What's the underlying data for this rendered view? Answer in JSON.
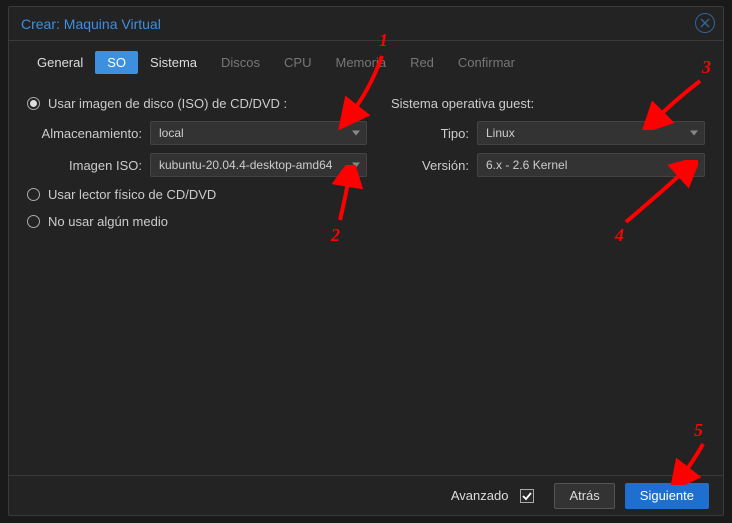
{
  "dialog": {
    "title": "Crear: Maquina Virtual"
  },
  "tabs": {
    "general": "General",
    "so": "SO",
    "sistema": "Sistema",
    "discos": "Discos",
    "cpu": "CPU",
    "memoria": "Memoria",
    "red": "Red",
    "confirmar": "Confirmar"
  },
  "left": {
    "radio_iso": "Usar imagen de disco (ISO) de CD/DVD :",
    "storage_label": "Almacenamiento:",
    "storage_value": "local",
    "iso_label": "Imagen ISO:",
    "iso_value": "kubuntu-20.04.4-desktop-amd64",
    "radio_physical": "Usar lector físico de CD/DVD",
    "radio_none": "No usar algún medio"
  },
  "right": {
    "section": "Sistema operativa guest:",
    "type_label": "Tipo:",
    "type_value": "Linux",
    "version_label": "Versión:",
    "version_value": "6.x - 2.6 Kernel"
  },
  "footer": {
    "advanced": "Avanzado",
    "back": "Atrás",
    "next": "Siguiente"
  },
  "annotations": {
    "a1": "1",
    "a2": "2",
    "a3": "3",
    "a4": "4",
    "a5": "5"
  }
}
